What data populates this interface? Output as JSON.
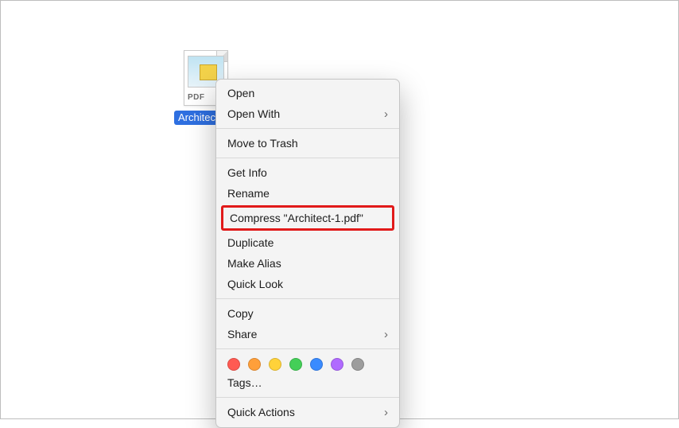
{
  "file": {
    "name": "Architect-1.pdf",
    "badge": "PDF"
  },
  "context_menu": {
    "open": "Open",
    "open_with": "Open With",
    "move_to_trash": "Move to Trash",
    "get_info": "Get Info",
    "rename": "Rename",
    "compress": "Compress \"Architect-1.pdf\"",
    "duplicate": "Duplicate",
    "make_alias": "Make Alias",
    "quick_look": "Quick Look",
    "copy": "Copy",
    "share": "Share",
    "tags": "Tags…",
    "quick_actions": "Quick Actions",
    "tag_colors": [
      "red",
      "orange",
      "yellow",
      "green",
      "blue",
      "purple",
      "gray"
    ]
  }
}
